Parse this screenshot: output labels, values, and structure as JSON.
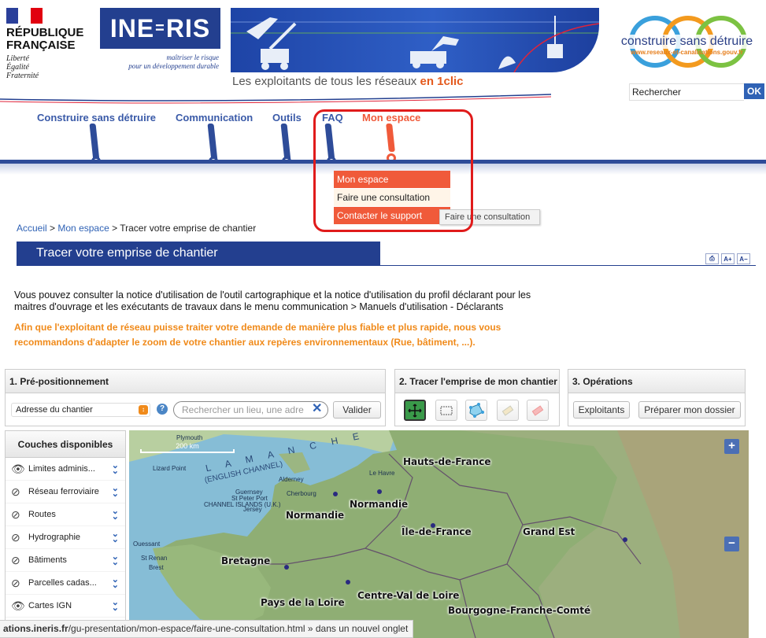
{
  "header": {
    "rf_title_line1": "RÉPUBLIQUE",
    "rf_title_line2": "FRANÇAISE",
    "rf_motto_1": "Liberté",
    "rf_motto_2": "Égalité",
    "rf_motto_3": "Fraternité",
    "ineris_logo": "INE-RIS",
    "ineris_tag_1": "maîtriser le risque",
    "ineris_tag_2": "pour un développement durable",
    "banner_caption": "Les exploitants de tous les réseaux",
    "banner_caption_emph": "en 1clic",
    "csd_title": "construire sans détruire",
    "csd_url": "www.reseaux-et-canalisations.gouv.fr",
    "search_value": "Rechercher",
    "search_ok": "OK"
  },
  "nav": {
    "items": [
      {
        "label": "Construire sans détruire"
      },
      {
        "label": "Communication"
      },
      {
        "label": "Outils"
      },
      {
        "label": "FAQ"
      },
      {
        "label": "Mon espace"
      }
    ],
    "dropdown": [
      "Mon espace",
      "Faire une consultation",
      "Contacter le support"
    ],
    "tooltip": "Faire une consultation"
  },
  "breadcrumb": {
    "home": "Accueil",
    "sep": ">",
    "space": "Mon espace",
    "current": "Tracer votre emprise de chantier"
  },
  "page": {
    "title": "Tracer votre emprise de chantier",
    "intro_1": "Vous pouvez consulter la notice d'utilisation de l'outil cartographique et la notice d'utilisation du profil déclarant pour les",
    "intro_2": "maitres d'ouvrage et les exécutants de travaux dans le menu communication > Manuels d'utilisation - Déclarants",
    "warning_1": "Afin que l'exploitant de réseau puisse traiter votre demande de manière plus fiable et plus rapide, nous vous",
    "warning_2": "recommandons d'adapter le zoom de votre chantier aux repères environnementaux (Rue, bâtiment, ...)."
  },
  "panels": {
    "prepos_title": "1. Pré-positionnement",
    "prepos_select": "Adresse du chantier",
    "prepos_placeholder": "Rechercher un lieu, une adre",
    "prepos_validate": "Valider",
    "draw_title": "2. Tracer l'emprise de mon chantier",
    "ops_title": "3. Opérations",
    "ops_exploitants": "Exploitants",
    "ops_dossier": "Préparer mon dossier"
  },
  "layers": {
    "title": "Couches disponibles",
    "items": [
      "Limites adminis...",
      "Réseau ferroviaire",
      "Routes",
      "Hydrographie",
      "Bâtiments",
      "Parcelles cadas...",
      "Cartes IGN"
    ]
  },
  "map": {
    "scale": "200 km",
    "regions": [
      "Hauts-de-France",
      "Normandie",
      "Normandie",
      "Île-de-France",
      "Grand Est",
      "Bretagne",
      "Centre-Val de Loire",
      "Pays de la Loire",
      "Bourgogne-Franche-Comté"
    ],
    "sea": "L A  M A N C H E",
    "sea_en": "(ENGLISH CHANNEL)",
    "minor": [
      "Lizard Point",
      "Guernsey",
      "Jersey",
      "CHANNEL ISLANDS (U.K.)",
      "Alderney",
      "St Peter Port",
      "Ouessant",
      "St Renan",
      "Brest",
      "Plymouth",
      "Le Havre",
      "Cherbourg"
    ],
    "zoom_in": "+",
    "zoom_out": "−"
  },
  "status": {
    "url_bold": "ations.ineris.fr",
    "url_rest": "/gu-presentation/mon-espace/faire-une-consultation.html » dans un nouvel onglet"
  },
  "colors": {
    "brand_blue": "#233f8f",
    "accent_orange": "#f05a3a",
    "warning_orange": "#f08a1a",
    "highlight_red": "#e01b1b"
  }
}
